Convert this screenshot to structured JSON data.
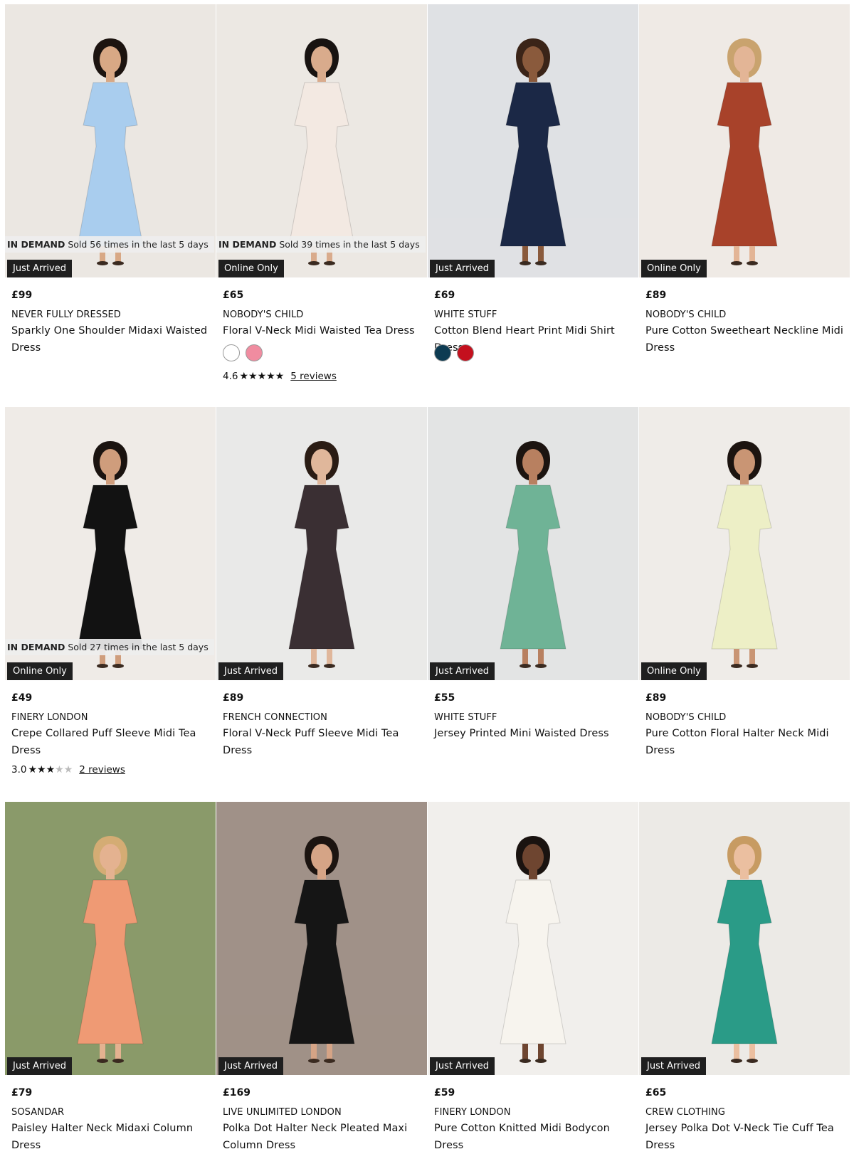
{
  "products": [
    {
      "id": "p1",
      "demand_label": "IN DEMAND",
      "demand_text": "Sold 56 times in the last 5 days",
      "badge": "Just Arrived",
      "price": "£99",
      "brand": "NEVER FULLY DRESSED",
      "title": "Sparkly One Shoulder Midaxi Waisted Dress",
      "bg": "#ebe7e2",
      "dress": "#a9cdee",
      "skin": "#d8a885",
      "hair": "#1c1410"
    },
    {
      "id": "p2",
      "demand_label": "IN DEMAND",
      "demand_text": "Sold 39 times in the last 5 days",
      "badge": "Online Only",
      "price": "£65",
      "brand": "NOBODY'S CHILD",
      "title": "Floral V-Neck Midi Waisted Tea Dress",
      "swatches": [
        "#ffffff",
        "#f08ca0"
      ],
      "rating": "4.6",
      "rating_value": 4.6,
      "reviews": "5 reviews",
      "bg": "#ece8e3",
      "dress": "#f3e9e2",
      "skin": "#d9ab8c",
      "hair": "#181311"
    },
    {
      "id": "p3",
      "badge": "Just Arrived",
      "price": "£69",
      "brand": "WHITE STUFF",
      "title": "Cotton Blend Heart Print Midi Shirt Dress",
      "swatches": [
        "#0d3b52",
        "#c4101e"
      ],
      "bg": "#dfe1e4",
      "dress": "#1b2846",
      "skin": "#8a5a3c",
      "hair": "#3a2418"
    },
    {
      "id": "p4",
      "badge": "Online Only",
      "price": "£89",
      "brand": "NOBODY'S CHILD",
      "title": "Pure Cotton Sweetheart Neckline Midi Dress",
      "bg": "#efeae5",
      "dress": "#a8422a",
      "skin": "#e3b596",
      "hair": "#c9a36e"
    },
    {
      "id": "p5",
      "demand_label": "IN DEMAND",
      "demand_text": "Sold 27 times in the last 5 days",
      "badge": "Online Only",
      "price": "£49",
      "brand": "FINERY LONDON",
      "title": "Crepe Collared Puff Sleeve Midi Tea Dress",
      "rating": "3.0",
      "rating_value": 3.0,
      "reviews": "2 reviews",
      "bg": "#efebe7",
      "dress": "#121212",
      "skin": "#cf9d7c",
      "hair": "#1a1310"
    },
    {
      "id": "p6",
      "badge": "Just Arrived",
      "price": "£89",
      "brand": "FRENCH CONNECTION",
      "title": "Floral V-Neck Puff Sleeve Midi Tea Dress",
      "bg": "#e9e9e8",
      "dress": "#3a2f33",
      "skin": "#e0b79b",
      "hair": "#2a1c14"
    },
    {
      "id": "p7",
      "badge": "Just Arrived",
      "price": "£55",
      "brand": "WHITE STUFF",
      "title": "Jersey Printed Mini Waisted Dress",
      "bg": "#e3e4e4",
      "dress": "#6fb396",
      "skin": "#b88060",
      "hair": "#1c1410"
    },
    {
      "id": "p8",
      "badge": "Online Only",
      "price": "£89",
      "brand": "NOBODY'S CHILD",
      "title": "Pure Cotton Floral Halter Neck Midi Dress",
      "bg": "#efece8",
      "dress": "#edefc6",
      "skin": "#c99574",
      "hair": "#1c1410"
    },
    {
      "id": "p9",
      "badge": "Just Arrived",
      "price": "£79",
      "brand": "SOSANDAR",
      "title": "Paisley Halter Neck Midaxi Column Dress",
      "bg": "#8a9a6a",
      "dress": "#ef9a74",
      "skin": "#e4b290",
      "hair": "#d4ac74"
    },
    {
      "id": "p10",
      "badge": "Just Arrived",
      "price": "£169",
      "brand": "LIVE UNLIMITED LONDON",
      "title": "Polka Dot Halter Neck Pleated Maxi Column Dress",
      "bg": "#a09188",
      "dress": "#151515",
      "skin": "#d5a486",
      "hair": "#1c1410"
    },
    {
      "id": "p11",
      "badge": "Just Arrived",
      "price": "£59",
      "brand": "FINERY LONDON",
      "title": "Pure Cotton Knitted Midi Bodycon Dress",
      "bg": "#f1efec",
      "dress": "#f7f4ee",
      "skin": "#6e4530",
      "hair": "#1a1310"
    },
    {
      "id": "p12",
      "badge": "Just Arrived",
      "price": "£65",
      "brand": "CREW CLOTHING",
      "title": "Jersey Polka Dot V-Neck Tie Cuff Tea Dress",
      "bg": "#eceae6",
      "dress": "#2a9b87",
      "skin": "#ebbfa0",
      "hair": "#c79b62"
    }
  ]
}
